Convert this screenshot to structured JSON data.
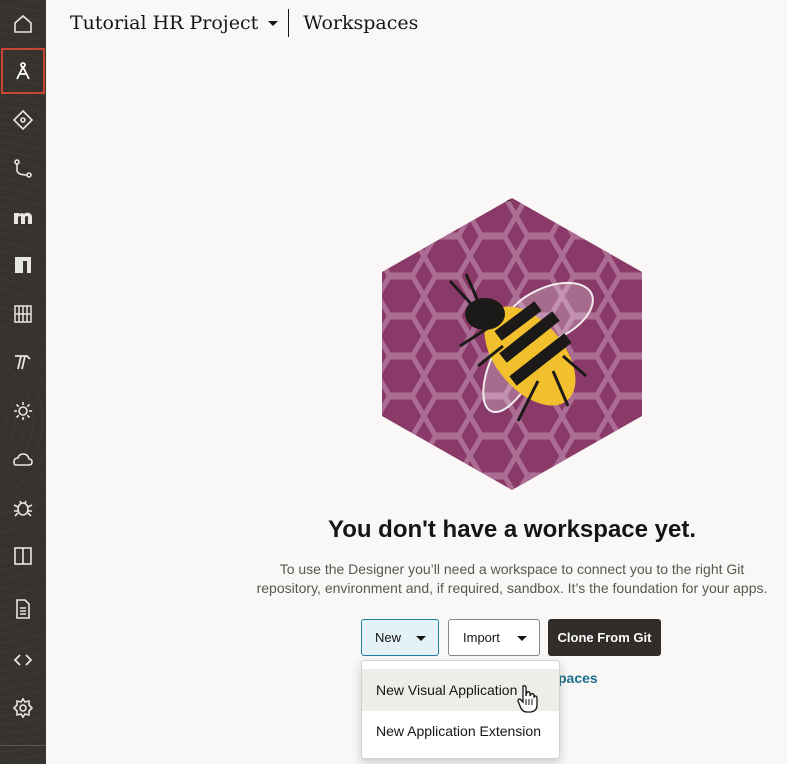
{
  "header": {
    "project_name": "Tutorial HR Project",
    "page_title": "Workspaces"
  },
  "sidebar": {
    "items": [
      {
        "name": "home-icon"
      },
      {
        "name": "designer-icon",
        "active": true
      },
      {
        "name": "git-icon"
      },
      {
        "name": "merge-requests-icon"
      },
      {
        "name": "maven-icon"
      },
      {
        "name": "npm-icon"
      },
      {
        "name": "board-icon"
      },
      {
        "name": "builds-icon"
      },
      {
        "name": "environments-icon"
      },
      {
        "name": "deployments-icon"
      },
      {
        "name": "issues-icon"
      },
      {
        "name": "boards-icon"
      },
      {
        "name": "wiki-icon"
      },
      {
        "name": "snippets-icon"
      },
      {
        "name": "settings-icon"
      }
    ]
  },
  "empty_state": {
    "title": "You don't have a workspace yet.",
    "description_line1": "To use the Designer you’ll need a workspace to connect you to the right Git",
    "description_line2": "repository, environment and, if required, sandbox. It’s the foundation for your apps."
  },
  "buttons": {
    "new_label": "New",
    "import_label": "Import",
    "clone_label": "Clone From Git"
  },
  "link_partial": "paces",
  "new_menu": {
    "items": [
      {
        "label": "New Visual Application",
        "hovered": true
      },
      {
        "label": "New Application Extension"
      }
    ]
  },
  "colors": {
    "sidebar_bg": "#36332f",
    "active_border": "#c74634",
    "accent": "#227e9e",
    "illustration_bg": "#8c3a6a",
    "bee_yellow": "#f2c02d"
  }
}
